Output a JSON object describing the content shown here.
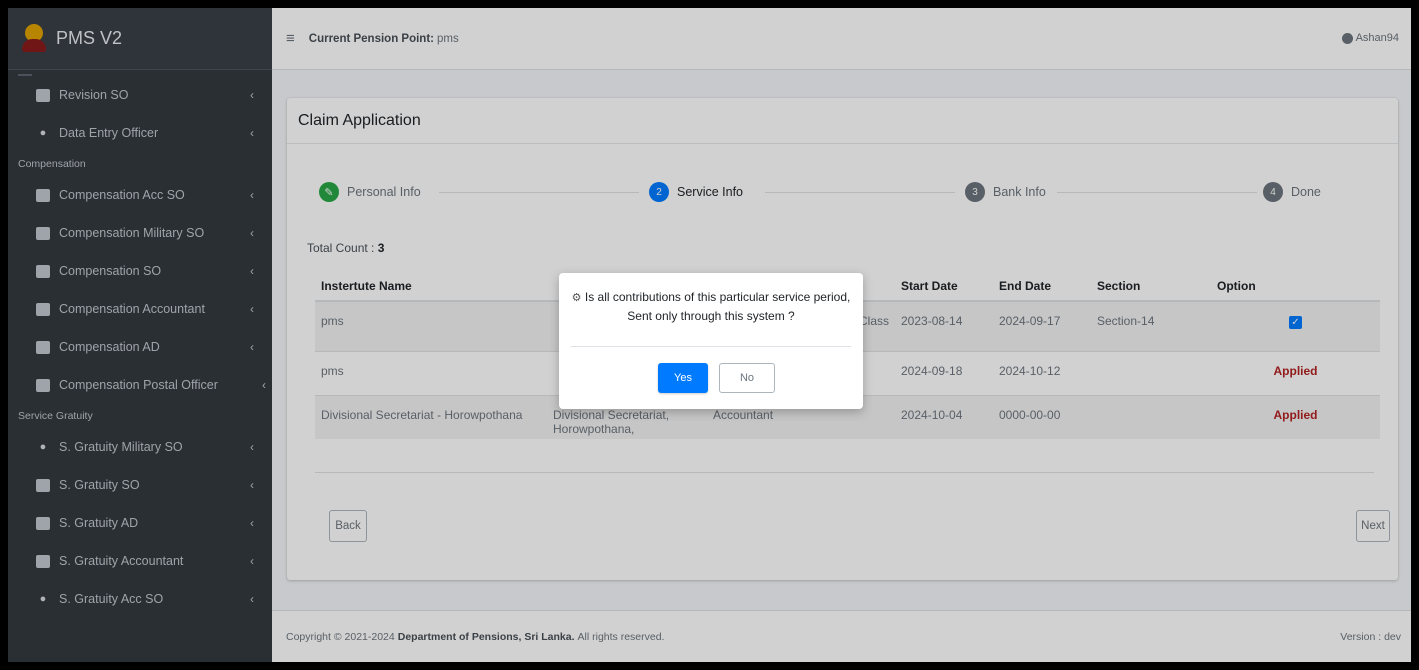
{
  "brand": {
    "title": "PMS V2"
  },
  "header": {
    "pension_point_label": "Current Pension Point:",
    "pension_point_value": "pms",
    "user": "Ashan94"
  },
  "sidebar": {
    "group1": [
      {
        "label": "Revision SO",
        "icon": "id-card-icon"
      },
      {
        "label": "Data Entry Officer",
        "icon": "users-icon"
      }
    ],
    "header_compensation": "Compensation",
    "compensation": [
      {
        "label": "Compensation Acc SO",
        "icon": "file-icon"
      },
      {
        "label": "Compensation Military SO",
        "icon": "list-icon"
      },
      {
        "label": "Compensation SO",
        "icon": "calendar-icon"
      },
      {
        "label": "Compensation Accountant",
        "icon": "id-card-icon"
      },
      {
        "label": "Compensation AD",
        "icon": "address-card-icon"
      },
      {
        "label": "Compensation Postal Officer",
        "icon": "id-card-icon"
      }
    ],
    "header_gratuity": "Service Gratuity",
    "gratuity": [
      {
        "label": "S. Gratuity Military SO",
        "icon": "users-icon"
      },
      {
        "label": "S. Gratuity SO",
        "icon": "id-card-icon"
      },
      {
        "label": "S. Gratuity AD",
        "icon": "id-card-icon"
      },
      {
        "label": "S. Gratuity Accountant",
        "icon": "id-card-icon"
      },
      {
        "label": "S. Gratuity Acc SO",
        "icon": "users-icon"
      }
    ]
  },
  "card": {
    "title": "Claim Application"
  },
  "steps": [
    {
      "num": "",
      "label": "Personal Info",
      "state": "done",
      "color": "#28a745"
    },
    {
      "num": "2",
      "label": "Service Info",
      "state": "active",
      "color": "#007bff"
    },
    {
      "num": "3",
      "label": "Bank Info",
      "state": "pending",
      "color": "#6c757d"
    },
    {
      "num": "4",
      "label": "Done",
      "state": "pending",
      "color": "#6c757d"
    }
  ],
  "total": {
    "label": "Total Count :",
    "value": "3"
  },
  "table": {
    "headers": [
      "Instertute Name",
      "",
      "",
      "Start Date",
      "End Date",
      "Section",
      "Option"
    ],
    "rows": [
      {
        "institute": "pms",
        "col2": "",
        "col3": "Class",
        "start": "2023-08-14",
        "end": "2024-09-17",
        "section": "Section-14",
        "option": "checked"
      },
      {
        "institute": "pms",
        "col2": "",
        "col3": "",
        "start": "2024-09-18",
        "end": "2024-10-12",
        "section": "",
        "option": "Applied"
      },
      {
        "institute": "Divisional Secretariat - Horowpothana",
        "col2": "Divisional Secretariat, Horowpothana,",
        "col3": "Accountant",
        "start": "2024-10-04",
        "end": "0000-00-00",
        "section": "",
        "option": "Applied"
      }
    ]
  },
  "buttons": {
    "back": "Back",
    "next": "Next"
  },
  "modal": {
    "message": "Is all contributions of this particular service period, Sent only through this system ?",
    "yes": "Yes",
    "no": "No"
  },
  "footer": {
    "prefix": "Copyright © 2021-2024",
    "org": "Department of Pensions, Sri Lanka.",
    "suffix": "All rights reserved.",
    "version": "Version : dev"
  }
}
